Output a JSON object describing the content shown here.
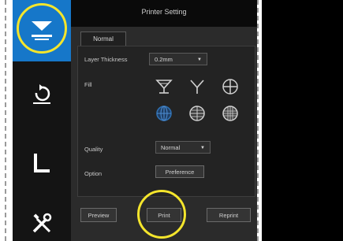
{
  "window": {
    "title": "Printer Setting"
  },
  "tabs": [
    {
      "label": "Normal",
      "active": true
    }
  ],
  "settings": {
    "layer_thickness": {
      "label": "Layer Thickness",
      "value": "0.2mm"
    },
    "fill": {
      "label": "Fill",
      "options": [
        {
          "icon": "fill-cup-icon",
          "selected": false
        },
        {
          "icon": "fill-tripod-icon",
          "selected": false
        },
        {
          "icon": "fill-crosshair-icon",
          "selected": false
        },
        {
          "icon": "fill-grid-sphere-icon",
          "selected": true
        },
        {
          "icon": "fill-mesh-sphere-icon",
          "selected": false
        },
        {
          "icon": "fill-dense-sphere-icon",
          "selected": false
        }
      ]
    },
    "quality": {
      "label": "Quality",
      "value": "Normal"
    },
    "option": {
      "label": "Option",
      "button": "Preference"
    }
  },
  "actions": {
    "preview": "Preview",
    "print": "Print",
    "reprint": "Reprint"
  },
  "sidebar": [
    {
      "name": "printer-icon",
      "active": true
    },
    {
      "name": "rotate-icon",
      "active": false
    },
    {
      "name": "axis-icon",
      "active": false
    },
    {
      "name": "tools-icon",
      "active": false
    }
  ],
  "colors": {
    "accent": "#1677c9",
    "panel_bg": "#2b2b2b",
    "highlight_circle": "#f4e52c",
    "selected_fill": "#2f6fb0"
  }
}
